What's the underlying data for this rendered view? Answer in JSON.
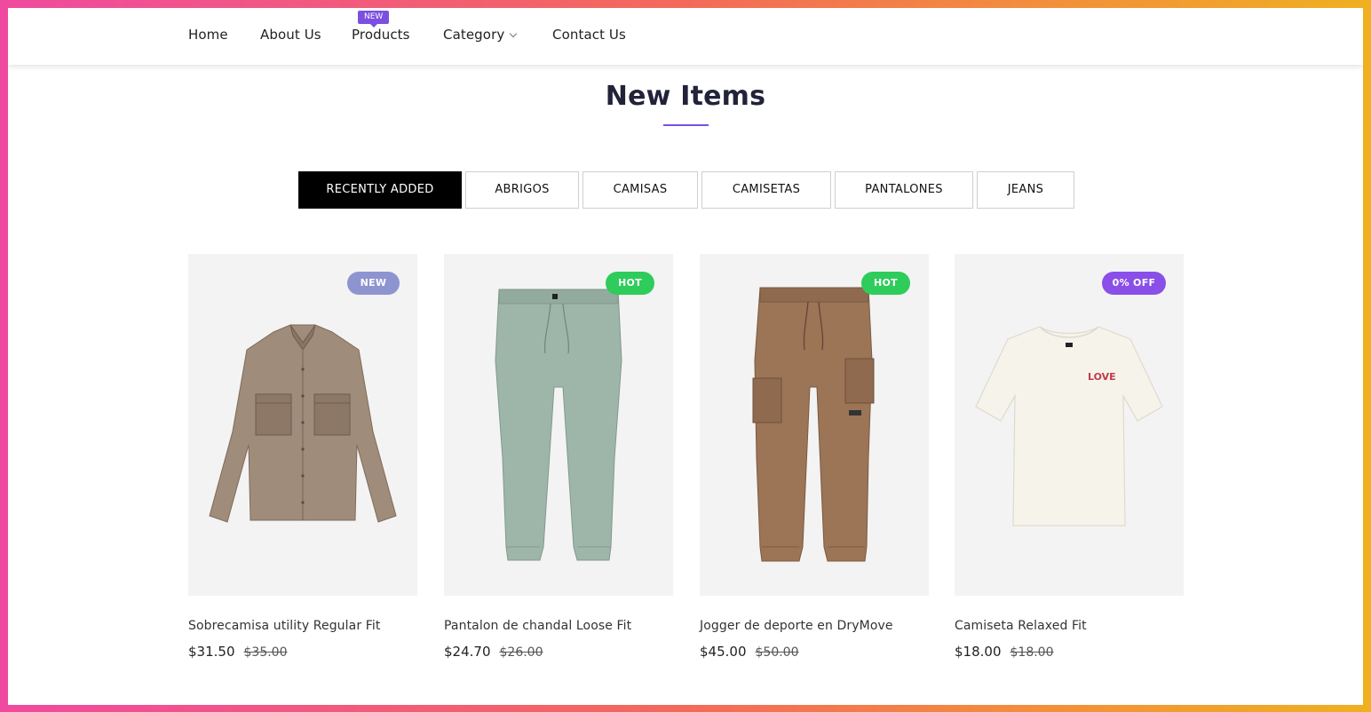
{
  "nav": {
    "items": [
      "Home",
      "About Us",
      "Products",
      "Category",
      "Contact Us"
    ],
    "products_badge": "NEW"
  },
  "section": {
    "title": "New Items"
  },
  "tabs": [
    "RECENTLY ADDED",
    "ABRIGOS",
    "CAMISAS",
    "CAMISETAS",
    "PANTALONES",
    "JEANS"
  ],
  "active_tab": "RECENTLY ADDED",
  "products": [
    {
      "name": "Sobrecamisa utility Regular Fit",
      "price": "$31.50",
      "old_price": "$35.00",
      "badge": "NEW",
      "badge_color": "#8d94d0",
      "garment": "shirt-icon",
      "color": "#a08c7a"
    },
    {
      "name": "Pantalon de chandal Loose Fit",
      "price": "$24.70",
      "old_price": "$26.00",
      "badge": "HOT",
      "badge_color": "#2ecc5a",
      "garment": "pants-icon",
      "color": "#9eb5aa"
    },
    {
      "name": "Jogger de deporte en DryMove",
      "price": "$45.00",
      "old_price": "$50.00",
      "badge": "HOT",
      "badge_color": "#2ecc5a",
      "garment": "cargo-pants-icon",
      "color": "#9c7456"
    },
    {
      "name": "Camiseta Relaxed Fit",
      "price": "$18.00",
      "old_price": "$18.00",
      "badge": "0% OFF",
      "badge_color": "#8a4fe8",
      "garment": "tshirt-icon",
      "color": "#f6f3ea",
      "print": "LOVE"
    }
  ],
  "colors": {
    "accent": "#7b4fe0",
    "hot": "#2ecc5a",
    "new": "#8d94d0"
  }
}
